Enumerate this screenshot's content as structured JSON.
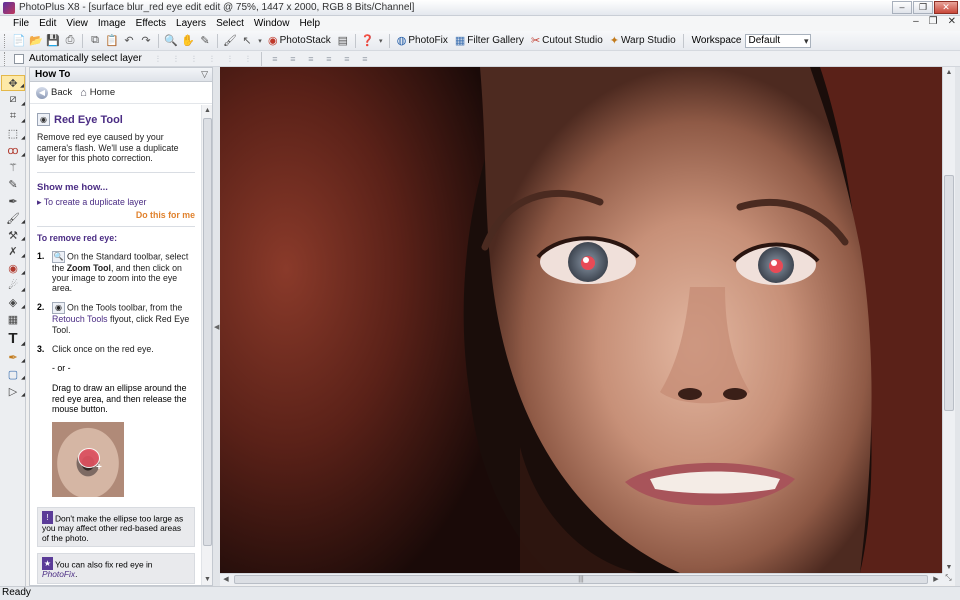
{
  "window": {
    "title": "PhotoPlus X8 - [surface blur_red eye edit edit @ 75%, 1447 x 2000, RGB 8 Bits/Channel]",
    "controls": [
      "–",
      "❐",
      "✕"
    ],
    "mdi_controls": [
      "–",
      "❐",
      "✕"
    ]
  },
  "menu": [
    "File",
    "Edit",
    "View",
    "Image",
    "Effects",
    "Layers",
    "Select",
    "Window",
    "Help"
  ],
  "toolbar": {
    "photostack": "PhotoStack",
    "photofix": "PhotoFix",
    "filter_gallery": "Filter Gallery",
    "cutout_studio": "Cutout Studio",
    "warp_studio": "Warp Studio",
    "workspace_label": "Workspace",
    "workspace_value": "Default"
  },
  "context_bar": {
    "auto_select_label": "Automatically select layer"
  },
  "howto": {
    "panel_title": "How To",
    "back": "Back",
    "home": "Home",
    "topic_title": "Red Eye Tool",
    "intro": "Remove red eye caused by your camera's flash. We'll use a duplicate layer for this photo correction.",
    "show_me": "Show me how...",
    "dup_link": "To create a duplicate layer",
    "do_this": "Do this for me",
    "remove_heading": "To remove red eye:",
    "step1_pre": "On the Standard toolbar, select the ",
    "step1_b": "Zoom Tool",
    "step1_post": ", and then click on your image to zoom into the eye area.",
    "step2_pre": "On the Tools toolbar, from the ",
    "step2_lnk": "Retouch Tools",
    "step2_mid": " flyout, click ",
    "step2_b": "Red Eye Tool",
    "step2_post": ".",
    "step3": "Click once on the red eye.",
    "or": "- or -",
    "drag": "Drag to draw an ellipse around the red eye area, and then release the mouse button.",
    "note1": "Don't make the ellipse too large as you may affect other red-based areas of the photo.",
    "note2_pre": "You can also fix red eye in ",
    "note2_lnk": "PhotoFix",
    "note2_post": "."
  },
  "status": {
    "text": "Ready"
  },
  "icons": {
    "zoom": "magnifier-icon",
    "red_eye": "eye-icon",
    "back": "back-arrow-icon",
    "home": "home-icon"
  }
}
